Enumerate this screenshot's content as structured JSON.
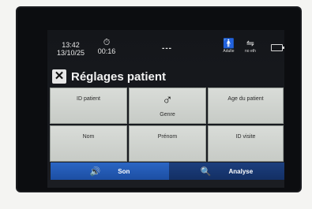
{
  "status": {
    "time": "13:42",
    "date": "13/10/25",
    "timer": "00:16",
    "center": "---",
    "patient_type": "Adulte",
    "eth": "no eth"
  },
  "header": {
    "close_icon": "✕",
    "title": "Réglages patient"
  },
  "fields": {
    "id_patient": "ID patient",
    "genre": "Genre",
    "genre_symbol": "♂",
    "age": "Age du patient",
    "nom": "Nom",
    "prenom": "Prénom",
    "id_visite": "ID visite"
  },
  "bottom": {
    "son": "Son",
    "analyse": "Analyse"
  },
  "colors": {
    "son_blue": "#2b66c4",
    "analyse_blue": "#1c3f7e",
    "cell_gray": "#d9dcd8"
  }
}
